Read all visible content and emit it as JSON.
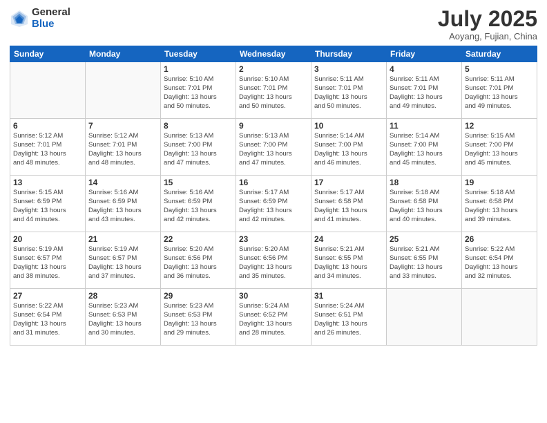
{
  "logo": {
    "general": "General",
    "blue": "Blue"
  },
  "header": {
    "month": "July 2025",
    "location": "Aoyang, Fujian, China"
  },
  "weekdays": [
    "Sunday",
    "Monday",
    "Tuesday",
    "Wednesday",
    "Thursday",
    "Friday",
    "Saturday"
  ],
  "weeks": [
    [
      {
        "day": "",
        "info": ""
      },
      {
        "day": "",
        "info": ""
      },
      {
        "day": "1",
        "info": "Sunrise: 5:10 AM\nSunset: 7:01 PM\nDaylight: 13 hours\nand 50 minutes."
      },
      {
        "day": "2",
        "info": "Sunrise: 5:10 AM\nSunset: 7:01 PM\nDaylight: 13 hours\nand 50 minutes."
      },
      {
        "day": "3",
        "info": "Sunrise: 5:11 AM\nSunset: 7:01 PM\nDaylight: 13 hours\nand 50 minutes."
      },
      {
        "day": "4",
        "info": "Sunrise: 5:11 AM\nSunset: 7:01 PM\nDaylight: 13 hours\nand 49 minutes."
      },
      {
        "day": "5",
        "info": "Sunrise: 5:11 AM\nSunset: 7:01 PM\nDaylight: 13 hours\nand 49 minutes."
      }
    ],
    [
      {
        "day": "6",
        "info": "Sunrise: 5:12 AM\nSunset: 7:01 PM\nDaylight: 13 hours\nand 48 minutes."
      },
      {
        "day": "7",
        "info": "Sunrise: 5:12 AM\nSunset: 7:01 PM\nDaylight: 13 hours\nand 48 minutes."
      },
      {
        "day": "8",
        "info": "Sunrise: 5:13 AM\nSunset: 7:00 PM\nDaylight: 13 hours\nand 47 minutes."
      },
      {
        "day": "9",
        "info": "Sunrise: 5:13 AM\nSunset: 7:00 PM\nDaylight: 13 hours\nand 47 minutes."
      },
      {
        "day": "10",
        "info": "Sunrise: 5:14 AM\nSunset: 7:00 PM\nDaylight: 13 hours\nand 46 minutes."
      },
      {
        "day": "11",
        "info": "Sunrise: 5:14 AM\nSunset: 7:00 PM\nDaylight: 13 hours\nand 45 minutes."
      },
      {
        "day": "12",
        "info": "Sunrise: 5:15 AM\nSunset: 7:00 PM\nDaylight: 13 hours\nand 45 minutes."
      }
    ],
    [
      {
        "day": "13",
        "info": "Sunrise: 5:15 AM\nSunset: 6:59 PM\nDaylight: 13 hours\nand 44 minutes."
      },
      {
        "day": "14",
        "info": "Sunrise: 5:16 AM\nSunset: 6:59 PM\nDaylight: 13 hours\nand 43 minutes."
      },
      {
        "day": "15",
        "info": "Sunrise: 5:16 AM\nSunset: 6:59 PM\nDaylight: 13 hours\nand 42 minutes."
      },
      {
        "day": "16",
        "info": "Sunrise: 5:17 AM\nSunset: 6:59 PM\nDaylight: 13 hours\nand 42 minutes."
      },
      {
        "day": "17",
        "info": "Sunrise: 5:17 AM\nSunset: 6:58 PM\nDaylight: 13 hours\nand 41 minutes."
      },
      {
        "day": "18",
        "info": "Sunrise: 5:18 AM\nSunset: 6:58 PM\nDaylight: 13 hours\nand 40 minutes."
      },
      {
        "day": "19",
        "info": "Sunrise: 5:18 AM\nSunset: 6:58 PM\nDaylight: 13 hours\nand 39 minutes."
      }
    ],
    [
      {
        "day": "20",
        "info": "Sunrise: 5:19 AM\nSunset: 6:57 PM\nDaylight: 13 hours\nand 38 minutes."
      },
      {
        "day": "21",
        "info": "Sunrise: 5:19 AM\nSunset: 6:57 PM\nDaylight: 13 hours\nand 37 minutes."
      },
      {
        "day": "22",
        "info": "Sunrise: 5:20 AM\nSunset: 6:56 PM\nDaylight: 13 hours\nand 36 minutes."
      },
      {
        "day": "23",
        "info": "Sunrise: 5:20 AM\nSunset: 6:56 PM\nDaylight: 13 hours\nand 35 minutes."
      },
      {
        "day": "24",
        "info": "Sunrise: 5:21 AM\nSunset: 6:55 PM\nDaylight: 13 hours\nand 34 minutes."
      },
      {
        "day": "25",
        "info": "Sunrise: 5:21 AM\nSunset: 6:55 PM\nDaylight: 13 hours\nand 33 minutes."
      },
      {
        "day": "26",
        "info": "Sunrise: 5:22 AM\nSunset: 6:54 PM\nDaylight: 13 hours\nand 32 minutes."
      }
    ],
    [
      {
        "day": "27",
        "info": "Sunrise: 5:22 AM\nSunset: 6:54 PM\nDaylight: 13 hours\nand 31 minutes."
      },
      {
        "day": "28",
        "info": "Sunrise: 5:23 AM\nSunset: 6:53 PM\nDaylight: 13 hours\nand 30 minutes."
      },
      {
        "day": "29",
        "info": "Sunrise: 5:23 AM\nSunset: 6:53 PM\nDaylight: 13 hours\nand 29 minutes."
      },
      {
        "day": "30",
        "info": "Sunrise: 5:24 AM\nSunset: 6:52 PM\nDaylight: 13 hours\nand 28 minutes."
      },
      {
        "day": "31",
        "info": "Sunrise: 5:24 AM\nSunset: 6:51 PM\nDaylight: 13 hours\nand 26 minutes."
      },
      {
        "day": "",
        "info": ""
      },
      {
        "day": "",
        "info": ""
      }
    ]
  ]
}
